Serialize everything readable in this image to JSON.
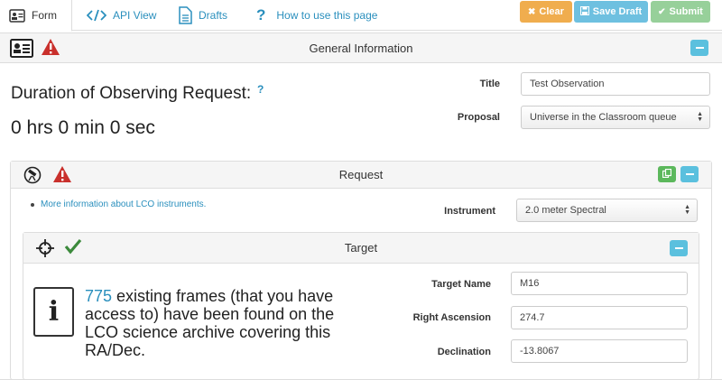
{
  "nav": {
    "form": "Form",
    "api_view": "API View",
    "drafts": "Drafts",
    "how_to": "How to use this page"
  },
  "actions": {
    "clear": "Clear",
    "save_draft": "Save Draft",
    "submit": "Submit"
  },
  "general": {
    "title": "General Information",
    "duration_label": "Duration of Observing Request:",
    "duration_help": "?",
    "duration_value": "0 hrs 0 min 0 sec",
    "title_label": "Title",
    "title_value": "Test Observation",
    "proposal_label": "Proposal",
    "proposal_value": "Universe in the Classroom queue"
  },
  "request": {
    "title": "Request",
    "info_link": "More information about LCO instruments.",
    "instrument_label": "Instrument",
    "instrument_value": "2.0 meter Spectral"
  },
  "target": {
    "title": "Target",
    "archive_count": "775",
    "archive_text": " existing frames (that you have access to) have been found on the LCO science archive covering this RA/Dec.",
    "name_label": "Target Name",
    "name_value": "M16",
    "ra_label": "Right Ascension",
    "ra_value": "274.7",
    "dec_label": "Declination",
    "dec_value": "-13.8067"
  },
  "icons": {
    "form": "id-card-icon",
    "api": "code-icon",
    "drafts": "document-icon",
    "help": "question-icon",
    "warning": "warning-icon",
    "telescope": "telescope-icon",
    "crosshair": "crosshair-icon",
    "check": "check-icon"
  },
  "colors": {
    "link": "#2a8fbd",
    "clear": "#f0ad4e",
    "save_draft": "#6ec0e0",
    "submit": "#97d09a",
    "warning": "#c9302c",
    "check": "#3c8a3c",
    "collapse": "#5bc0de",
    "copy": "#5cb85c"
  }
}
